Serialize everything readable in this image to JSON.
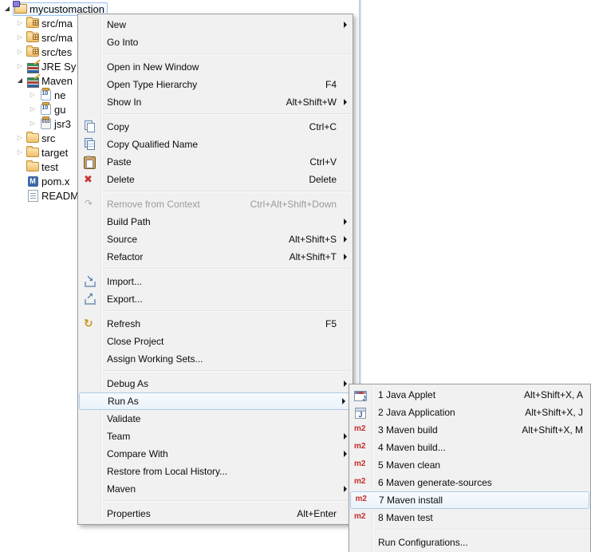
{
  "colors": {
    "menu_background": "#F1F1F1",
    "menu_border": "#9C9C9C",
    "highlight_fill": "#EAF2FB",
    "highlight_border": "#AECBE8",
    "disabled_text": "#9A9A9A",
    "m2_red": "#C92B2B",
    "selection_border": "#9CC3E8",
    "panel_line_blue": "#CFDEEF"
  },
  "project_tree": {
    "items": [
      {
        "label": "mycustomaction",
        "level": 0,
        "state": "expanded",
        "icon": "project-icon",
        "selected": true
      },
      {
        "label": "src/ma",
        "level": 1,
        "state": "collapsed",
        "icon": "source-folder-icon"
      },
      {
        "label": "src/ma",
        "level": 1,
        "state": "collapsed",
        "icon": "source-folder-icon"
      },
      {
        "label": "src/tes",
        "level": 1,
        "state": "collapsed",
        "icon": "source-folder-icon"
      },
      {
        "label": "JRE Sy",
        "level": 1,
        "state": "collapsed",
        "icon": "library-icon"
      },
      {
        "label": "Maven",
        "level": 1,
        "state": "expanded",
        "icon": "library-icon"
      },
      {
        "label": "ne",
        "level": 2,
        "state": "collapsed",
        "icon": "jar-icon"
      },
      {
        "label": "gu",
        "level": 2,
        "state": "collapsed",
        "icon": "jar-icon"
      },
      {
        "label": "jsr3",
        "level": 2,
        "state": "collapsed",
        "icon": "jar-binary-icon"
      },
      {
        "label": "src",
        "level": 1,
        "state": "collapsed",
        "icon": "folder-icon"
      },
      {
        "label": "target",
        "level": 1,
        "state": "collapsed",
        "icon": "folder-icon"
      },
      {
        "label": "test",
        "level": 1,
        "state": "none",
        "icon": "folder-icon"
      },
      {
        "label": "pom.x",
        "level": 1,
        "state": "none",
        "icon": "maven-pom-icon"
      },
      {
        "label": "READM",
        "level": 1,
        "state": "none",
        "icon": "text-file-icon"
      }
    ]
  },
  "context_menu": {
    "items": [
      {
        "type": "item",
        "label": "New",
        "submenu": true
      },
      {
        "type": "item",
        "label": "Go Into"
      },
      {
        "type": "separator"
      },
      {
        "type": "item",
        "label": "Open in New Window"
      },
      {
        "type": "item",
        "label": "Open Type Hierarchy",
        "shortcut": "F4"
      },
      {
        "type": "item",
        "label": "Show In",
        "shortcut": "Alt+Shift+W",
        "submenu": true
      },
      {
        "type": "separator"
      },
      {
        "type": "item",
        "label": "Copy",
        "icon": "copy-icon",
        "shortcut": "Ctrl+C"
      },
      {
        "type": "item",
        "label": "Copy Qualified Name",
        "icon": "copy-qualified-name-icon"
      },
      {
        "type": "item",
        "label": "Paste",
        "icon": "paste-icon",
        "shortcut": "Ctrl+V"
      },
      {
        "type": "item",
        "label": "Delete",
        "icon": "delete-icon",
        "shortcut": "Delete"
      },
      {
        "type": "separator"
      },
      {
        "type": "item",
        "label": "Remove from Context",
        "icon": "remove-from-context-icon",
        "shortcut": "Ctrl+Alt+Shift+Down",
        "disabled": true
      },
      {
        "type": "item",
        "label": "Build Path",
        "submenu": true
      },
      {
        "type": "item",
        "label": "Source",
        "shortcut": "Alt+Shift+S",
        "submenu": true
      },
      {
        "type": "item",
        "label": "Refactor",
        "shortcut": "Alt+Shift+T",
        "submenu": true
      },
      {
        "type": "separator"
      },
      {
        "type": "item",
        "label": "Import...",
        "icon": "import-icon"
      },
      {
        "type": "item",
        "label": "Export...",
        "icon": "export-icon"
      },
      {
        "type": "separator"
      },
      {
        "type": "item",
        "label": "Refresh",
        "icon": "refresh-icon",
        "shortcut": "F5"
      },
      {
        "type": "item",
        "label": "Close Project"
      },
      {
        "type": "item",
        "label": "Assign Working Sets..."
      },
      {
        "type": "separator"
      },
      {
        "type": "item",
        "label": "Debug As",
        "submenu": true
      },
      {
        "type": "item",
        "label": "Run As",
        "submenu": true,
        "highlighted": true
      },
      {
        "type": "item",
        "label": "Validate"
      },
      {
        "type": "item",
        "label": "Team",
        "submenu": true
      },
      {
        "type": "item",
        "label": "Compare With",
        "submenu": true
      },
      {
        "type": "item",
        "label": "Restore from Local History..."
      },
      {
        "type": "item",
        "label": "Maven",
        "submenu": true
      },
      {
        "type": "separator"
      },
      {
        "type": "item",
        "label": "Properties",
        "shortcut": "Alt+Enter"
      }
    ]
  },
  "run_as_submenu": {
    "items": [
      {
        "type": "item",
        "label": "1 Java Applet",
        "icon": "java-applet-icon",
        "shortcut": "Alt+Shift+X, A"
      },
      {
        "type": "item",
        "label": "2 Java Application",
        "icon": "java-application-icon",
        "shortcut": "Alt+Shift+X, J"
      },
      {
        "type": "item",
        "label": "3 Maven build",
        "icon": "m2-icon",
        "shortcut": "Alt+Shift+X, M"
      },
      {
        "type": "item",
        "label": "4 Maven build...",
        "icon": "m2-icon"
      },
      {
        "type": "item",
        "label": "5 Maven clean",
        "icon": "m2-icon"
      },
      {
        "type": "item",
        "label": "6 Maven generate-sources",
        "icon": "m2-icon"
      },
      {
        "type": "item",
        "label": "7 Maven install",
        "icon": "m2-icon",
        "highlighted": true
      },
      {
        "type": "item",
        "label": "8 Maven test",
        "icon": "m2-icon"
      },
      {
        "type": "separator"
      },
      {
        "type": "item",
        "label": "Run Configurations..."
      }
    ]
  }
}
